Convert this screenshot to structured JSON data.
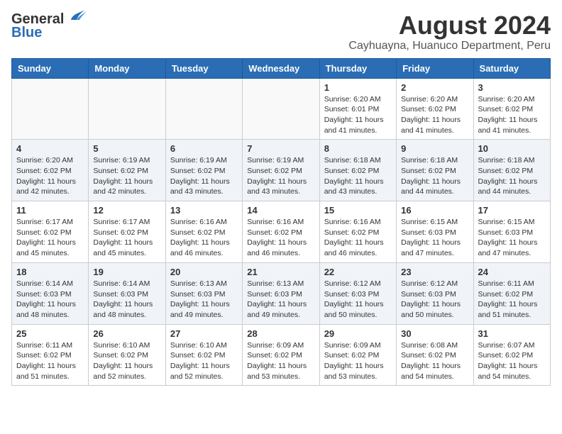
{
  "logo": {
    "line1": "General",
    "line2": "Blue"
  },
  "title": "August 2024",
  "subtitle": "Cayhuayna, Huanuco Department, Peru",
  "days_of_week": [
    "Sunday",
    "Monday",
    "Tuesday",
    "Wednesday",
    "Thursday",
    "Friday",
    "Saturday"
  ],
  "weeks": [
    [
      {
        "day": "",
        "info": ""
      },
      {
        "day": "",
        "info": ""
      },
      {
        "day": "",
        "info": ""
      },
      {
        "day": "",
        "info": ""
      },
      {
        "day": "1",
        "info": "Sunrise: 6:20 AM\nSunset: 6:01 PM\nDaylight: 11 hours and 41 minutes."
      },
      {
        "day": "2",
        "info": "Sunrise: 6:20 AM\nSunset: 6:02 PM\nDaylight: 11 hours and 41 minutes."
      },
      {
        "day": "3",
        "info": "Sunrise: 6:20 AM\nSunset: 6:02 PM\nDaylight: 11 hours and 41 minutes."
      }
    ],
    [
      {
        "day": "4",
        "info": "Sunrise: 6:20 AM\nSunset: 6:02 PM\nDaylight: 11 hours and 42 minutes."
      },
      {
        "day": "5",
        "info": "Sunrise: 6:19 AM\nSunset: 6:02 PM\nDaylight: 11 hours and 42 minutes."
      },
      {
        "day": "6",
        "info": "Sunrise: 6:19 AM\nSunset: 6:02 PM\nDaylight: 11 hours and 43 minutes."
      },
      {
        "day": "7",
        "info": "Sunrise: 6:19 AM\nSunset: 6:02 PM\nDaylight: 11 hours and 43 minutes."
      },
      {
        "day": "8",
        "info": "Sunrise: 6:18 AM\nSunset: 6:02 PM\nDaylight: 11 hours and 43 minutes."
      },
      {
        "day": "9",
        "info": "Sunrise: 6:18 AM\nSunset: 6:02 PM\nDaylight: 11 hours and 44 minutes."
      },
      {
        "day": "10",
        "info": "Sunrise: 6:18 AM\nSunset: 6:02 PM\nDaylight: 11 hours and 44 minutes."
      }
    ],
    [
      {
        "day": "11",
        "info": "Sunrise: 6:17 AM\nSunset: 6:02 PM\nDaylight: 11 hours and 45 minutes."
      },
      {
        "day": "12",
        "info": "Sunrise: 6:17 AM\nSunset: 6:02 PM\nDaylight: 11 hours and 45 minutes."
      },
      {
        "day": "13",
        "info": "Sunrise: 6:16 AM\nSunset: 6:02 PM\nDaylight: 11 hours and 46 minutes."
      },
      {
        "day": "14",
        "info": "Sunrise: 6:16 AM\nSunset: 6:02 PM\nDaylight: 11 hours and 46 minutes."
      },
      {
        "day": "15",
        "info": "Sunrise: 6:16 AM\nSunset: 6:02 PM\nDaylight: 11 hours and 46 minutes."
      },
      {
        "day": "16",
        "info": "Sunrise: 6:15 AM\nSunset: 6:03 PM\nDaylight: 11 hours and 47 minutes."
      },
      {
        "day": "17",
        "info": "Sunrise: 6:15 AM\nSunset: 6:03 PM\nDaylight: 11 hours and 47 minutes."
      }
    ],
    [
      {
        "day": "18",
        "info": "Sunrise: 6:14 AM\nSunset: 6:03 PM\nDaylight: 11 hours and 48 minutes."
      },
      {
        "day": "19",
        "info": "Sunrise: 6:14 AM\nSunset: 6:03 PM\nDaylight: 11 hours and 48 minutes."
      },
      {
        "day": "20",
        "info": "Sunrise: 6:13 AM\nSunset: 6:03 PM\nDaylight: 11 hours and 49 minutes."
      },
      {
        "day": "21",
        "info": "Sunrise: 6:13 AM\nSunset: 6:03 PM\nDaylight: 11 hours and 49 minutes."
      },
      {
        "day": "22",
        "info": "Sunrise: 6:12 AM\nSunset: 6:03 PM\nDaylight: 11 hours and 50 minutes."
      },
      {
        "day": "23",
        "info": "Sunrise: 6:12 AM\nSunset: 6:03 PM\nDaylight: 11 hours and 50 minutes."
      },
      {
        "day": "24",
        "info": "Sunrise: 6:11 AM\nSunset: 6:02 PM\nDaylight: 11 hours and 51 minutes."
      }
    ],
    [
      {
        "day": "25",
        "info": "Sunrise: 6:11 AM\nSunset: 6:02 PM\nDaylight: 11 hours and 51 minutes."
      },
      {
        "day": "26",
        "info": "Sunrise: 6:10 AM\nSunset: 6:02 PM\nDaylight: 11 hours and 52 minutes."
      },
      {
        "day": "27",
        "info": "Sunrise: 6:10 AM\nSunset: 6:02 PM\nDaylight: 11 hours and 52 minutes."
      },
      {
        "day": "28",
        "info": "Sunrise: 6:09 AM\nSunset: 6:02 PM\nDaylight: 11 hours and 53 minutes."
      },
      {
        "day": "29",
        "info": "Sunrise: 6:09 AM\nSunset: 6:02 PM\nDaylight: 11 hours and 53 minutes."
      },
      {
        "day": "30",
        "info": "Sunrise: 6:08 AM\nSunset: 6:02 PM\nDaylight: 11 hours and 54 minutes."
      },
      {
        "day": "31",
        "info": "Sunrise: 6:07 AM\nSunset: 6:02 PM\nDaylight: 11 hours and 54 minutes."
      }
    ]
  ]
}
